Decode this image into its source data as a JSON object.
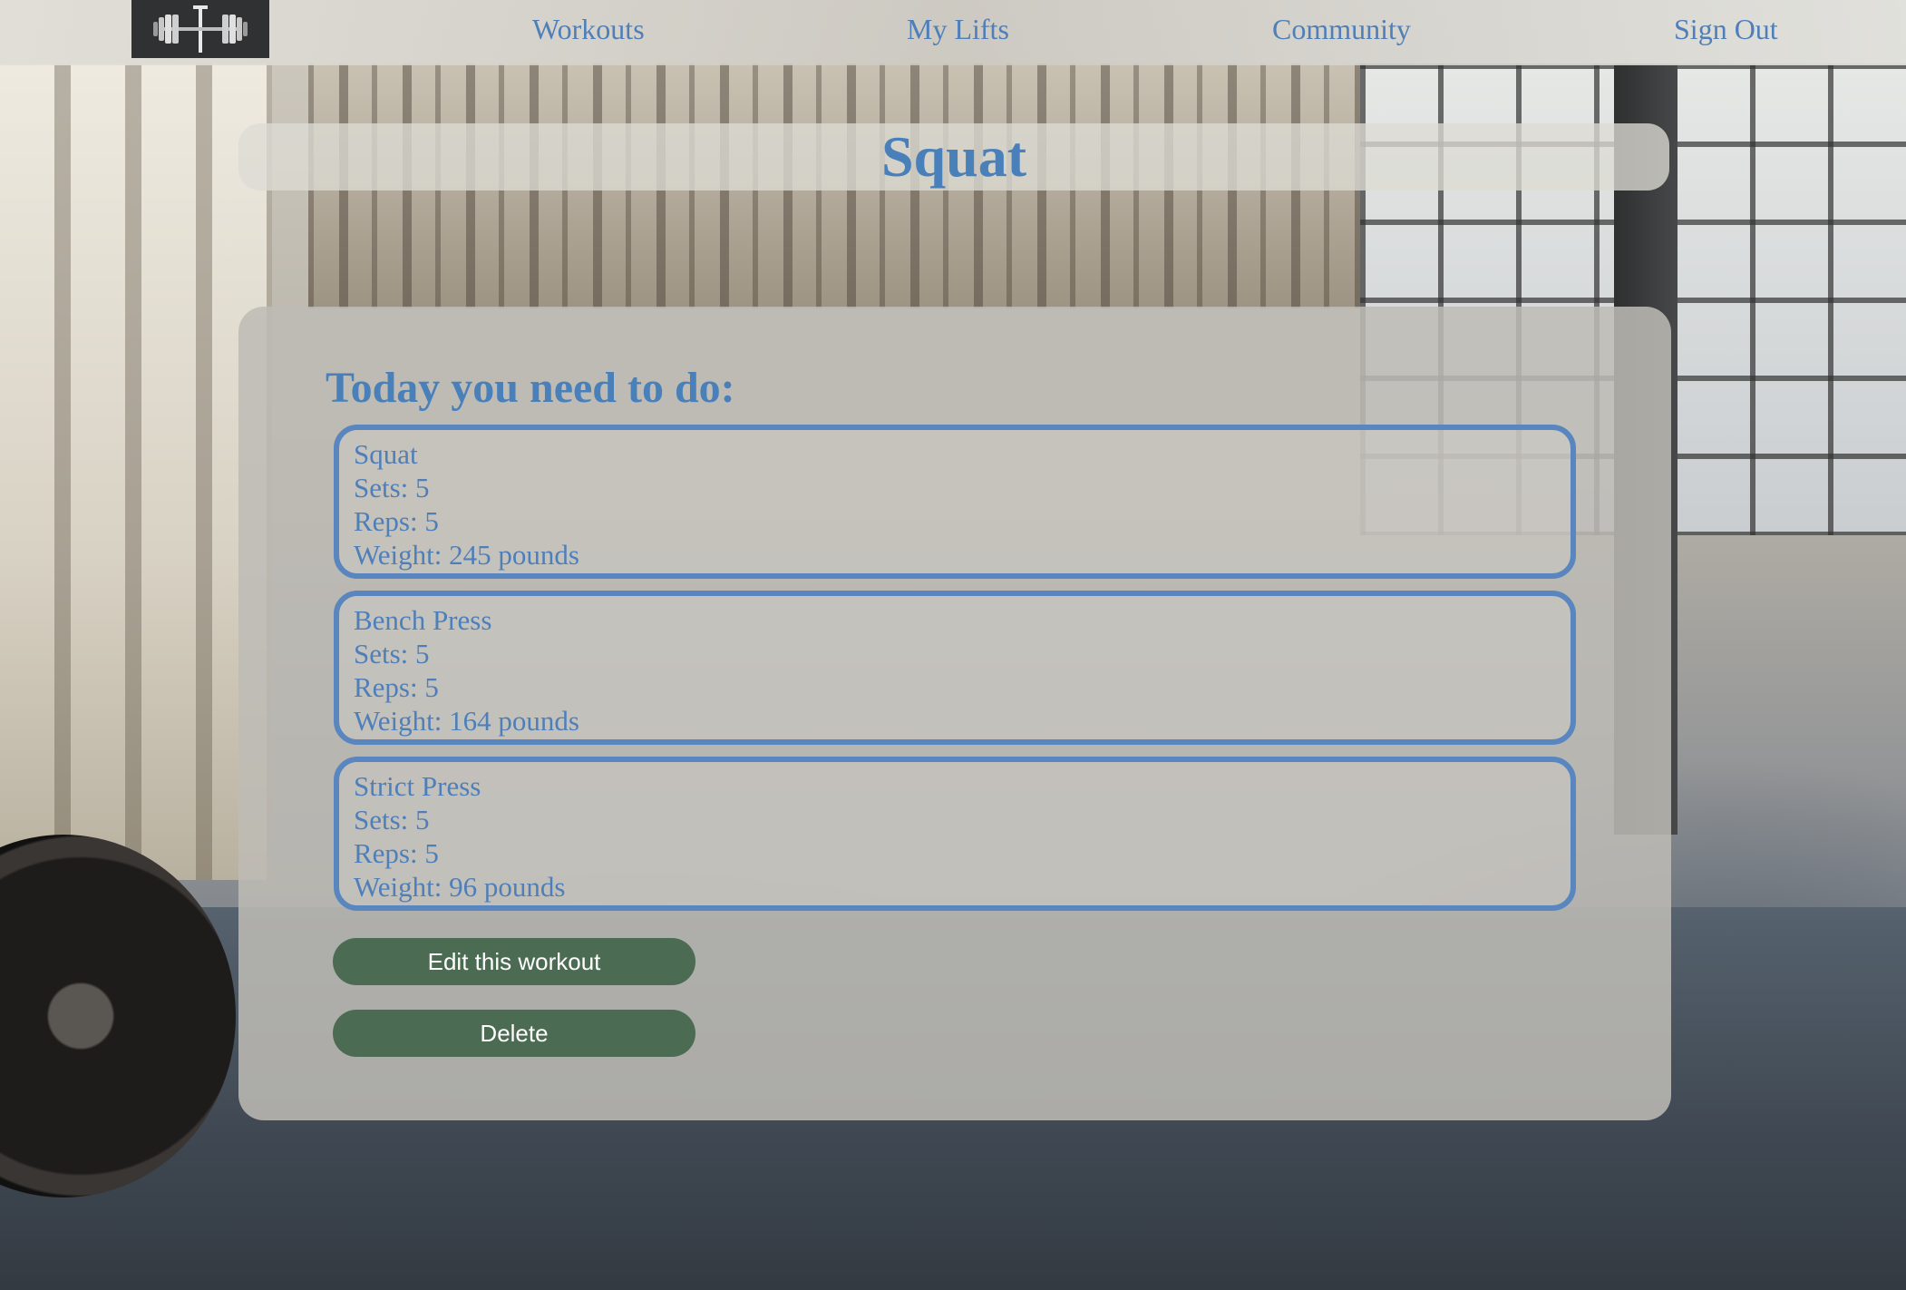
{
  "nav": {
    "logo_icon": "barbell-logo-icon",
    "links": [
      "Workouts",
      "My Lifts",
      "Community",
      "Sign Out"
    ]
  },
  "page": {
    "title": "Squat",
    "heading": "Today you need to do:"
  },
  "exercises": [
    {
      "name": "Squat",
      "sets": "Sets: 5",
      "reps": "Reps: 5",
      "weight": "Weight: 245 pounds"
    },
    {
      "name": "Bench Press",
      "sets": "Sets: 5",
      "reps": "Reps: 5",
      "weight": "Weight: 164 pounds"
    },
    {
      "name": "Strict Press",
      "sets": "Sets: 5",
      "reps": "Reps: 5",
      "weight": "Weight: 96 pounds"
    }
  ],
  "actions": {
    "edit_label": "Edit this workout",
    "delete_label": "Delete"
  },
  "colors": {
    "accent_blue": "#4a80b9",
    "button_green": "#4b6b52",
    "logo_bg": "#2f3133"
  }
}
